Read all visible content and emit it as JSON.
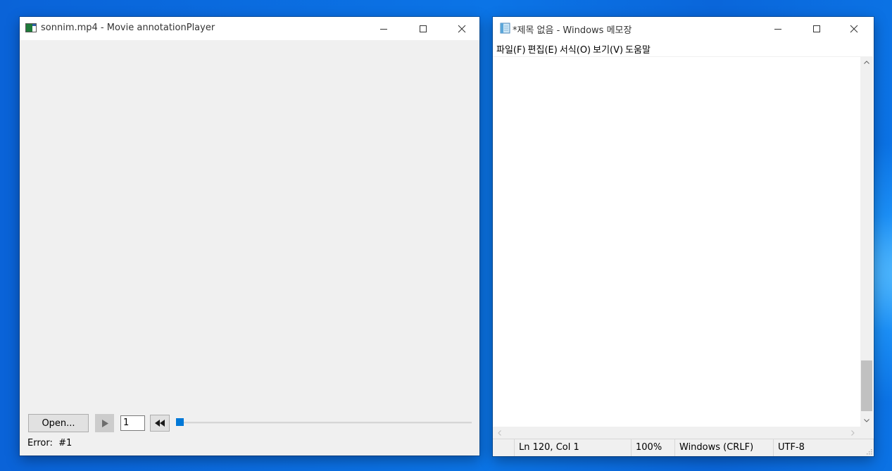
{
  "player": {
    "title": "sonnim.mp4 - Movie annotationPlayer",
    "open_label": "Open...",
    "frame_value": "1",
    "error_text": "Error:  #1"
  },
  "notepad": {
    "title": "*제목 없음 - Windows 메모장",
    "menu": [
      "파일(F)",
      "편집(E)",
      "서식(O)",
      "보기(V)",
      "도움말"
    ],
    "status": {
      "position": "Ln 120, Col 1",
      "zoom": "100%",
      "line_ending": "Windows (CRLF)",
      "encoding": "UTF-8"
    }
  },
  "colors": {
    "accent": "#0078d7",
    "desktop": "#0b74e6"
  }
}
